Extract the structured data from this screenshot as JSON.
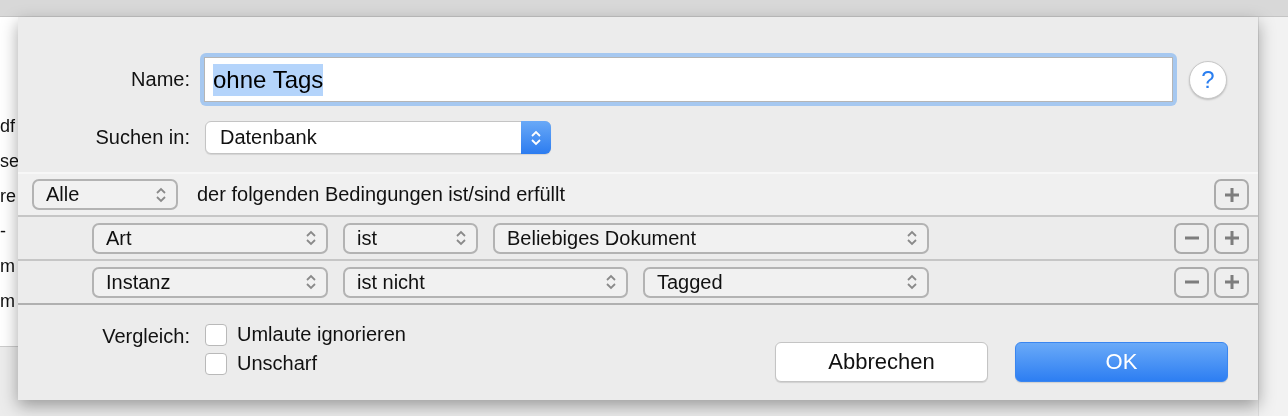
{
  "background": {
    "row_fragments": [
      "df",
      "se",
      "re",
      "-",
      "m",
      "m"
    ]
  },
  "dialog": {
    "name": {
      "label": "Name:",
      "value": "ohne Tags",
      "focused": true,
      "text_selected": true
    },
    "help": "?",
    "scope": {
      "label": "Suchen in:",
      "value": "Datenbank"
    },
    "criteria_header": {
      "quantifier": "Alle",
      "text": "der folgenden Bedingungen ist/sind erfüllt"
    },
    "criteria": [
      {
        "field": "Art",
        "operator": "ist",
        "value": "Beliebiges Dokument"
      },
      {
        "field": "Instanz",
        "operator": "ist nicht",
        "value": "Tagged"
      }
    ],
    "compare": {
      "label": "Vergleich:",
      "options": [
        {
          "label": "Umlaute ignorieren",
          "checked": false
        },
        {
          "label": "Unscharf",
          "checked": false
        }
      ]
    },
    "buttons": [
      {
        "label": "Abbrechen",
        "default": false
      },
      {
        "label": "OK",
        "default": true
      }
    ]
  }
}
